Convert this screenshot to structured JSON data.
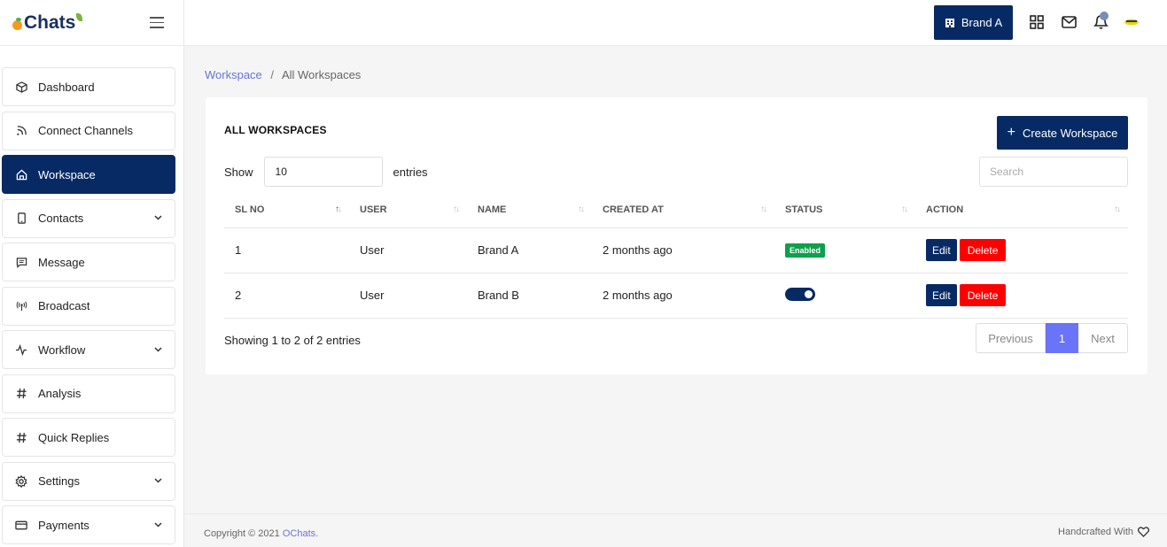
{
  "app": {
    "logo_text": "Chats"
  },
  "header": {
    "brand_button": "Brand A"
  },
  "sidebar": {
    "items": [
      {
        "label": "Dashboard",
        "icon": "cube-icon",
        "has_chevron": false,
        "active": false
      },
      {
        "label": "Connect Channels",
        "icon": "rss-icon",
        "has_chevron": false,
        "active": false
      },
      {
        "label": "Workspace",
        "icon": "home-icon",
        "has_chevron": false,
        "active": true
      },
      {
        "label": "Contacts",
        "icon": "phone-icon",
        "has_chevron": true,
        "active": false
      },
      {
        "label": "Message",
        "icon": "message-icon",
        "has_chevron": false,
        "active": false
      },
      {
        "label": "Broadcast",
        "icon": "broadcast-icon",
        "has_chevron": false,
        "active": false
      },
      {
        "label": "Workflow",
        "icon": "activity-icon",
        "has_chevron": true,
        "active": false
      },
      {
        "label": "Analysis",
        "icon": "hash-icon",
        "has_chevron": false,
        "active": false
      },
      {
        "label": "Quick Replies",
        "icon": "hash-icon",
        "has_chevron": false,
        "active": false
      },
      {
        "label": "Settings",
        "icon": "gear-icon",
        "has_chevron": true,
        "active": false
      },
      {
        "label": "Payments",
        "icon": "credit-card-icon",
        "has_chevron": true,
        "active": false
      }
    ]
  },
  "breadcrumb": {
    "root": "Workspace",
    "separator": "/",
    "current": "All Workspaces"
  },
  "card": {
    "title": "ALL WORKSPACES",
    "create_button": "Create Workspace",
    "show_label": "Show",
    "show_value": "10",
    "entries_label": "entries",
    "search_placeholder": "Search"
  },
  "table": {
    "columns": [
      "SL NO",
      "USER",
      "NAME",
      "CREATED AT",
      "STATUS",
      "ACTION"
    ],
    "rows": [
      {
        "sl": "1",
        "user": "User",
        "name": "Brand A",
        "created": "2 months ago",
        "status": "Enabled",
        "status_type": "badge"
      },
      {
        "sl": "2",
        "user": "User",
        "name": "Brand B",
        "created": "2 months ago",
        "status": "",
        "status_type": "toggle"
      }
    ],
    "edit_label": "Edit",
    "delete_label": "Delete"
  },
  "pagination": {
    "info": "Showing 1 to 2 of 2 entries",
    "previous": "Previous",
    "page": "1",
    "next": "Next"
  },
  "footer": {
    "copyright": "Copyright © 2021 ",
    "brand_link": "OChats.",
    "handcrafted": "Handcrafted With"
  },
  "colors": {
    "primary": "#072a64",
    "accent": "#6a74f8",
    "success": "#0ea04b",
    "danger": "#ff0000"
  }
}
